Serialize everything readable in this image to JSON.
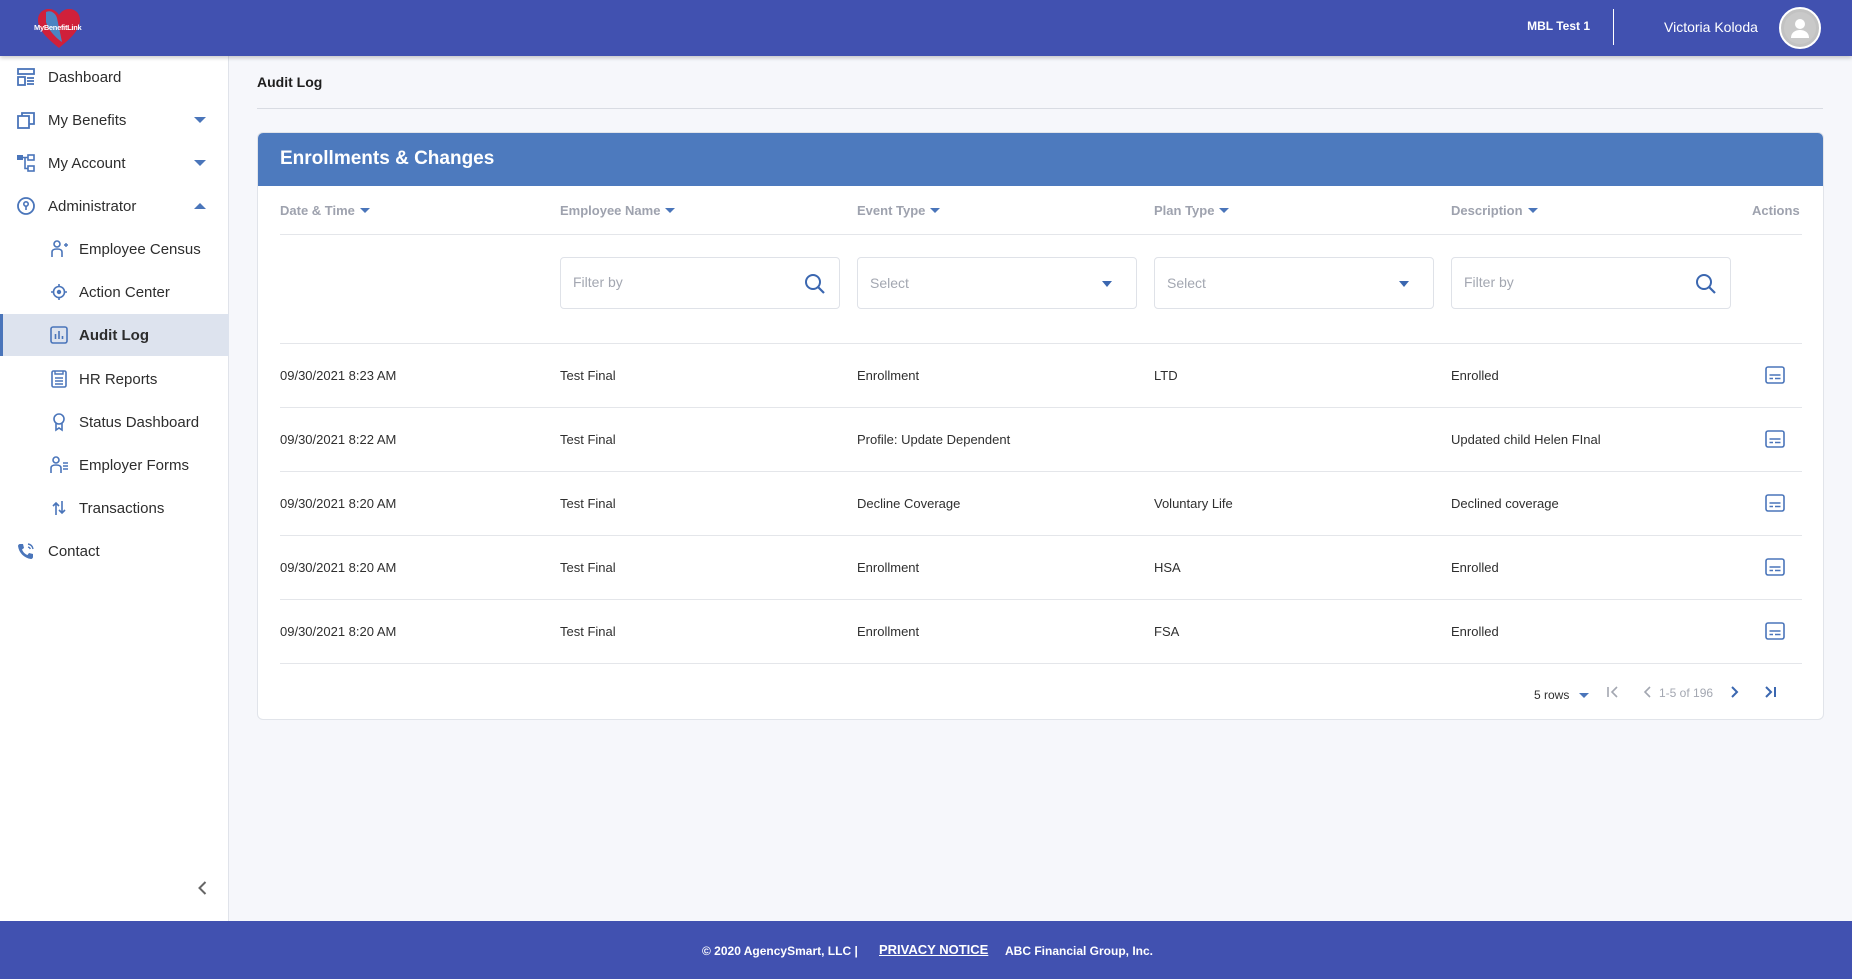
{
  "header": {
    "logo_text": "MyBenefitLink",
    "organization": "MBL Test 1",
    "user_name": "Victoria Koloda",
    "avatar_icon": "user-avatar-icon"
  },
  "sidebar": {
    "items": [
      {
        "label": "Dashboard",
        "icon": "dashboard-icon"
      },
      {
        "label": "My Benefits",
        "icon": "benefits-icon",
        "expandable": true,
        "expanded": false
      },
      {
        "label": "My Account",
        "icon": "account-tree-icon",
        "expandable": true,
        "expanded": false
      },
      {
        "label": "Administrator",
        "icon": "admin-key-icon",
        "expandable": true,
        "expanded": true
      },
      {
        "label": "Employee Census",
        "icon": "add-person-icon",
        "sub": true
      },
      {
        "label": "Action Center",
        "icon": "target-icon",
        "sub": true
      },
      {
        "label": "Audit Log",
        "icon": "bar-chart-icon",
        "sub": true,
        "active": true
      },
      {
        "label": "HR Reports",
        "icon": "report-icon",
        "sub": true
      },
      {
        "label": "Status Dashboard",
        "icon": "award-icon",
        "sub": true
      },
      {
        "label": "Employer Forms",
        "icon": "person-list-icon",
        "sub": true
      },
      {
        "label": "Transactions",
        "icon": "transfer-arrows-icon",
        "sub": true
      },
      {
        "label": "Contact",
        "icon": "phone-icon"
      }
    ],
    "collapse_icon": "chevron-left-icon"
  },
  "main": {
    "page_title": "Audit Log",
    "card_title": "Enrollments & Changes",
    "columns": [
      "Date & Time",
      "Employee Name",
      "Event Type",
      "Plan Type",
      "Description",
      "Actions"
    ],
    "filters": {
      "employee_name_placeholder": "Filter by",
      "event_type_value": "Select",
      "plan_type_value": "Select",
      "description_placeholder": "Filter by"
    },
    "rows": [
      {
        "datetime": "09/30/2021 8:23 AM",
        "employee": "Test Final",
        "event": "Enrollment",
        "plan": "LTD",
        "description": "Enrolled"
      },
      {
        "datetime": "09/30/2021 8:22 AM",
        "employee": "Test Final",
        "event": "Profile: Update Dependent",
        "plan": "",
        "description": "Updated child Helen FInal"
      },
      {
        "datetime": "09/30/2021 8:20 AM",
        "employee": "Test Final",
        "event": "Decline Coverage",
        "plan": "Voluntary Life",
        "description": "Declined coverage"
      },
      {
        "datetime": "09/30/2021 8:20 AM",
        "employee": "Test Final",
        "event": "Enrollment",
        "plan": "HSA",
        "description": "Enrolled"
      },
      {
        "datetime": "09/30/2021 8:20 AM",
        "employee": "Test Final",
        "event": "Enrollment",
        "plan": "FSA",
        "description": "Enrolled"
      }
    ],
    "pagination": {
      "rows_per_page": "5 rows",
      "range": "1-5 of 196"
    }
  },
  "footer": {
    "copyright": "© 2020 AgencySmart, LLC |",
    "privacy": "PRIVACY NOTICE",
    "company": "ABC Financial Group, Inc."
  },
  "colors": {
    "topbar": "#4151b0",
    "card_header": "#4d7abe",
    "accent": "#4a75ba"
  }
}
